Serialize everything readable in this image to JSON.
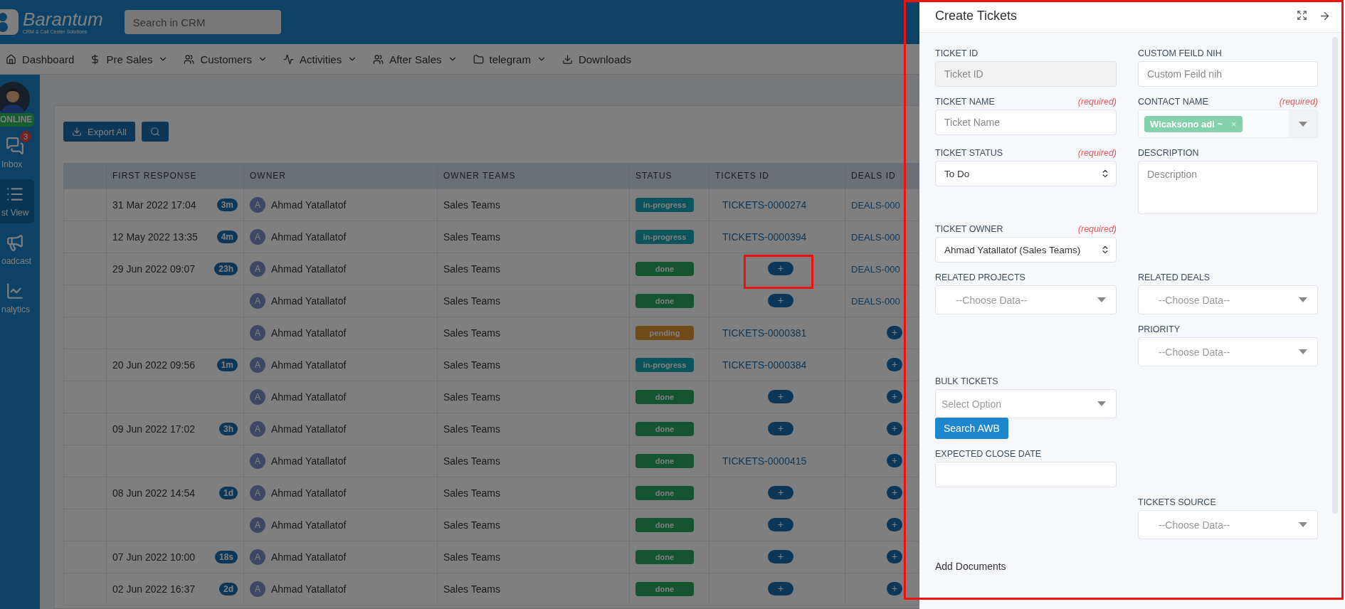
{
  "header": {
    "logo": {
      "name": "Barantum",
      "tagline": "CRM & Call Center Solutions"
    },
    "search": {
      "placeholder": "Search in CRM"
    }
  },
  "nav": [
    {
      "label": "Dashboard",
      "dropdown": false
    },
    {
      "label": "Pre Sales",
      "dropdown": true
    },
    {
      "label": "Customers",
      "dropdown": true
    },
    {
      "label": "Activities",
      "dropdown": true
    },
    {
      "label": "After Sales",
      "dropdown": true
    },
    {
      "label": "telegram",
      "dropdown": true
    },
    {
      "label": "Downloads",
      "dropdown": false
    }
  ],
  "sidebar": {
    "status": "ONLINE",
    "items": [
      {
        "label": "Inbox",
        "badge": "3",
        "selected": false
      },
      {
        "label": "st View",
        "selected": true
      },
      {
        "label": "oadcast",
        "selected": false
      },
      {
        "label": "nalytics",
        "selected": false
      }
    ]
  },
  "toolbar": {
    "export": "Export All"
  },
  "table": {
    "columns": [
      "FIRST RESPONSE",
      "OWNER",
      "OWNER TEAMS",
      "STATUS",
      "TICKETS ID",
      "DEALS ID"
    ],
    "rows": [
      {
        "first_response": "31 Mar 2022 17:04",
        "elapsed": "3m",
        "owner_initial": "A",
        "owner": "Ahmad Yatallatof",
        "team": "Sales Teams",
        "status": {
          "text": "in-progress",
          "kind": "progress"
        },
        "ticket": {
          "kind": "link",
          "text": "TICKETS-0000274"
        },
        "deal": {
          "kind": "link",
          "text": "DEALS-000"
        }
      },
      {
        "first_response": "12 May 2022 13:35",
        "elapsed": "4m",
        "owner_initial": "A",
        "owner": "Ahmad Yatallatof",
        "team": "Sales Teams",
        "status": {
          "text": "in-progress",
          "kind": "progress"
        },
        "ticket": {
          "kind": "link",
          "text": "TICKETS-0000394"
        },
        "deal": {
          "kind": "link",
          "text": "DEALS-000"
        }
      },
      {
        "first_response": "29 Jun 2022 09:07",
        "elapsed": "23h",
        "owner_initial": "A",
        "owner": "Ahmad Yatallatof",
        "team": "Sales Teams",
        "status": {
          "text": "done",
          "kind": "done"
        },
        "ticket": {
          "kind": "add",
          "text": "+"
        },
        "deal": {
          "kind": "link",
          "text": "DEALS-000"
        }
      },
      {
        "owner_initial": "A",
        "owner": "Ahmad Yatallatof",
        "team": "Sales Teams",
        "status": {
          "text": "done",
          "kind": "done"
        },
        "ticket": {
          "kind": "add",
          "text": "+"
        },
        "deal": {
          "kind": "link",
          "text": "DEALS-000"
        }
      },
      {
        "owner_initial": "A",
        "owner": "Ahmad Yatallatof",
        "team": "Sales Teams",
        "status": {
          "text": "pending",
          "kind": "pending"
        },
        "ticket": {
          "kind": "link",
          "text": "TICKETS-0000381"
        },
        "deal": {
          "kind": "add",
          "text": "+"
        }
      },
      {
        "first_response": "20 Jun 2022 09:56",
        "elapsed": "1m",
        "owner_initial": "A",
        "owner": "Ahmad Yatallatof",
        "team": "Sales Teams",
        "status": {
          "text": "in-progress",
          "kind": "progress"
        },
        "ticket": {
          "kind": "link",
          "text": "TICKETS-0000384"
        },
        "deal": {
          "kind": "add",
          "text": "+"
        }
      },
      {
        "owner_initial": "A",
        "owner": "Ahmad Yatallatof",
        "team": "Sales Teams",
        "status": {
          "text": "done",
          "kind": "done"
        },
        "ticket": {
          "kind": "add",
          "text": "+"
        },
        "deal": {
          "kind": "add",
          "text": "+"
        }
      },
      {
        "first_response": "09 Jun 2022 17:02",
        "elapsed": "3h",
        "owner_initial": "A",
        "owner": "Ahmad Yatallatof",
        "team": "Sales Teams",
        "status": {
          "text": "done",
          "kind": "done"
        },
        "ticket": {
          "kind": "add",
          "text": "+"
        },
        "deal": {
          "kind": "add",
          "text": "+"
        }
      },
      {
        "owner_initial": "A",
        "owner": "Ahmad Yatallatof",
        "team": "Sales Teams",
        "status": {
          "text": "done",
          "kind": "done"
        },
        "ticket": {
          "kind": "link",
          "text": "TICKETS-0000415"
        },
        "deal": {
          "kind": "add",
          "text": "+"
        }
      },
      {
        "first_response": "08 Jun 2022 14:54",
        "elapsed": "1d",
        "owner_initial": "A",
        "owner": "Ahmad Yatallatof",
        "team": "Sales Teams",
        "status": {
          "text": "done",
          "kind": "done"
        },
        "ticket": {
          "kind": "add",
          "text": "+"
        },
        "deal": {
          "kind": "add",
          "text": "+"
        }
      },
      {
        "owner_initial": "A",
        "owner": "Ahmad Yatallatof",
        "team": "Sales Teams",
        "status": {
          "text": "done",
          "kind": "done"
        },
        "ticket": {
          "kind": "add",
          "text": "+"
        },
        "deal": {
          "kind": "add",
          "text": "+"
        }
      },
      {
        "first_response": "07 Jun 2022 10:00",
        "elapsed": "18s",
        "owner_initial": "A",
        "owner": "Ahmad Yatallatof",
        "team": "Sales Teams",
        "status": {
          "text": "done",
          "kind": "done"
        },
        "ticket": {
          "kind": "add",
          "text": "+"
        },
        "deal": {
          "kind": "add",
          "text": "+"
        }
      },
      {
        "first_response": "02 Jun 2022 16:37",
        "elapsed": "2d",
        "owner_initial": "A",
        "owner": "Ahmad Yatallatof",
        "team": "Sales Teams",
        "status": {
          "text": "done",
          "kind": "done"
        },
        "ticket": {
          "kind": "add",
          "text": "+"
        },
        "deal": {
          "kind": "add",
          "text": "+"
        }
      }
    ]
  },
  "panel": {
    "title": "Create Tickets",
    "form": [
      {
        "left": {
          "label": "TICKET ID",
          "kind": "input",
          "placeholder": "Ticket ID",
          "disabled": true
        },
        "right": {
          "label": "CUSTOM FEILD NIH",
          "kind": "input",
          "placeholder": "Custom Feild nih",
          "disabled": false
        }
      },
      {
        "left": {
          "label": "TICKET NAME",
          "required": "(required)",
          "kind": "input",
          "placeholder": "Ticket Name",
          "disabled": false
        },
        "right": {
          "label": "CONTACT NAME",
          "required": "(required)",
          "kind": "tags",
          "tags": [
            "Wicaksono adi ~"
          ],
          "remove": "×"
        }
      },
      {
        "left": {
          "label": "TICKET STATUS",
          "required": "(required)",
          "kind": "native-select",
          "value": "To Do"
        },
        "right": {
          "label": "DESCRIPTION",
          "kind": "textarea",
          "placeholder": "Description"
        }
      },
      {
        "left": {
          "label": "TICKET OWNER",
          "required": "(required)",
          "kind": "native-select",
          "value": "Ahmad Yatallatof (Sales Teams)"
        }
      },
      {
        "left": {
          "label": "RELATED PROJECTS",
          "kind": "select",
          "placeholder": "--Choose Data--"
        },
        "right": {
          "label": "RELATED DEALS",
          "kind": "select",
          "placeholder": "--Choose Data--"
        }
      },
      {
        "right": {
          "label": "PRIORITY",
          "kind": "select",
          "placeholder": "--Choose Data--"
        }
      },
      {
        "left": {
          "label": "BULK TICKETS",
          "kind": "select",
          "placeholder": "Select Option",
          "action": "Search AWB"
        }
      },
      {
        "left": {
          "label": "EXPECTED CLOSE DATE",
          "kind": "input",
          "disabled": false
        }
      },
      {
        "right": {
          "label": "TICKETS SOURCE",
          "kind": "select",
          "placeholder": "--Choose Data--"
        }
      }
    ],
    "footer_label": "Add Documents"
  }
}
